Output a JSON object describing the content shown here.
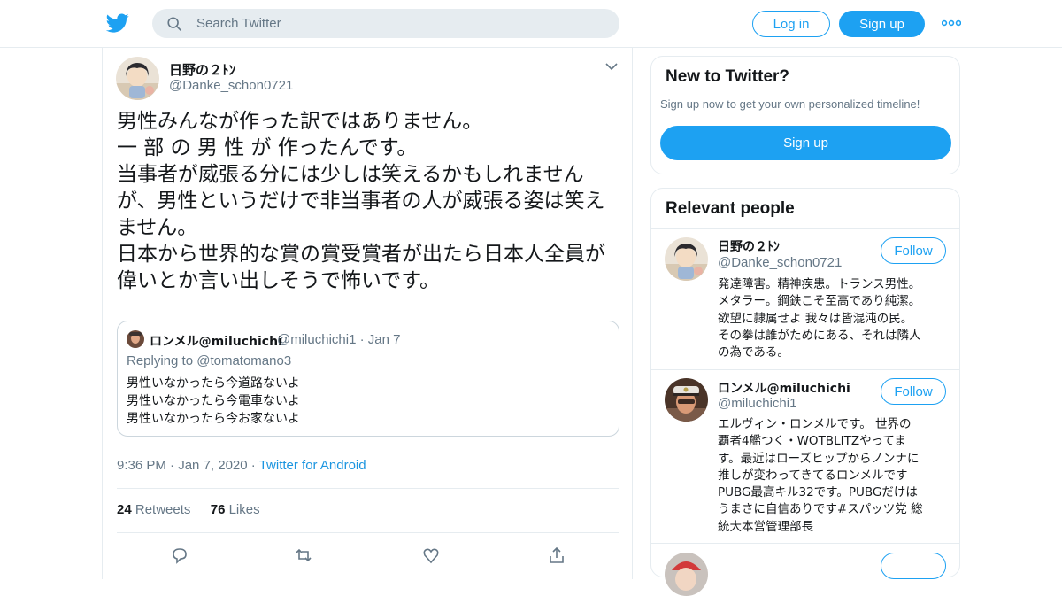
{
  "header": {
    "search_placeholder": "Search Twitter",
    "login_label": "Log in",
    "signup_label": "Sign up",
    "brand_color": "#1da1f2"
  },
  "tweet": {
    "author_name": "日野の２ﾄﾝ",
    "author_handle": "@Danke_schon0721",
    "text_lines": [
      "男性みんなが作った訳ではありません。",
      "一 部 の 男 性 が 作ったんです。",
      "当事者が威張る分には少しは笑えるかもしれません",
      "が、男性というだけで非当事者の人が威張る姿は笑え",
      "ません。",
      "日本から世界的な賞の賞受賞者が出たら日本人全員が",
      "偉いとか言い出しそうで怖いです。"
    ],
    "quote": {
      "name": "ロンメル@miluchichi",
      "handle": "@miluchichi1",
      "date": "Jan 7",
      "replying_prefix": "Replying to",
      "replying_to": "@tomatomano3",
      "lines": [
        "男性いなかったら今道路ないよ",
        "男性いなかったら今電車ないよ",
        "男性いなかったら今お家ないよ"
      ]
    },
    "time": "9:36 PM",
    "date": "Jan 7, 2020",
    "source": "Twitter for Android",
    "retweets_count": "24",
    "retweets_label": "Retweets",
    "likes_count": "76",
    "likes_label": "Likes",
    "actions": [
      "reply-icon",
      "retweet-icon",
      "like-icon",
      "share-icon"
    ]
  },
  "sidebar": {
    "new_title": "New to Twitter?",
    "new_subtitle": "Sign up now to get your own personalized timeline!",
    "new_signup_label": "Sign up",
    "relevant_title": "Relevant people",
    "people": [
      {
        "name": "日野の２ﾄﾝ",
        "handle": "@Danke_schon0721",
        "follow_label": "Follow",
        "bio_lines": [
          "発達障害。精神疾患。トランス男性。",
          "メタラー。鋼鉄こそ至高であり純潔。",
          "欲望に隷属せよ 我々は皆混沌の民。",
          "その拳は誰がためにある、それは隣人",
          "の為である。"
        ]
      },
      {
        "name": "ロンメル@miluchichi",
        "handle": "@miluchichi1",
        "follow_label": "Follow",
        "bio_lines": [
          "エルヴィン・ロンメルです。 世界の",
          "覇者4艦つく・WOTBLITZやってま",
          "す。最近はローズヒップからノンナに",
          "推しが変わってきてるロンメルです",
          "PUBG最高キル32です。PUBGだけは",
          "うまさに自信ありです#スパッツ党 総",
          "統大本営管理部長"
        ]
      }
    ]
  }
}
